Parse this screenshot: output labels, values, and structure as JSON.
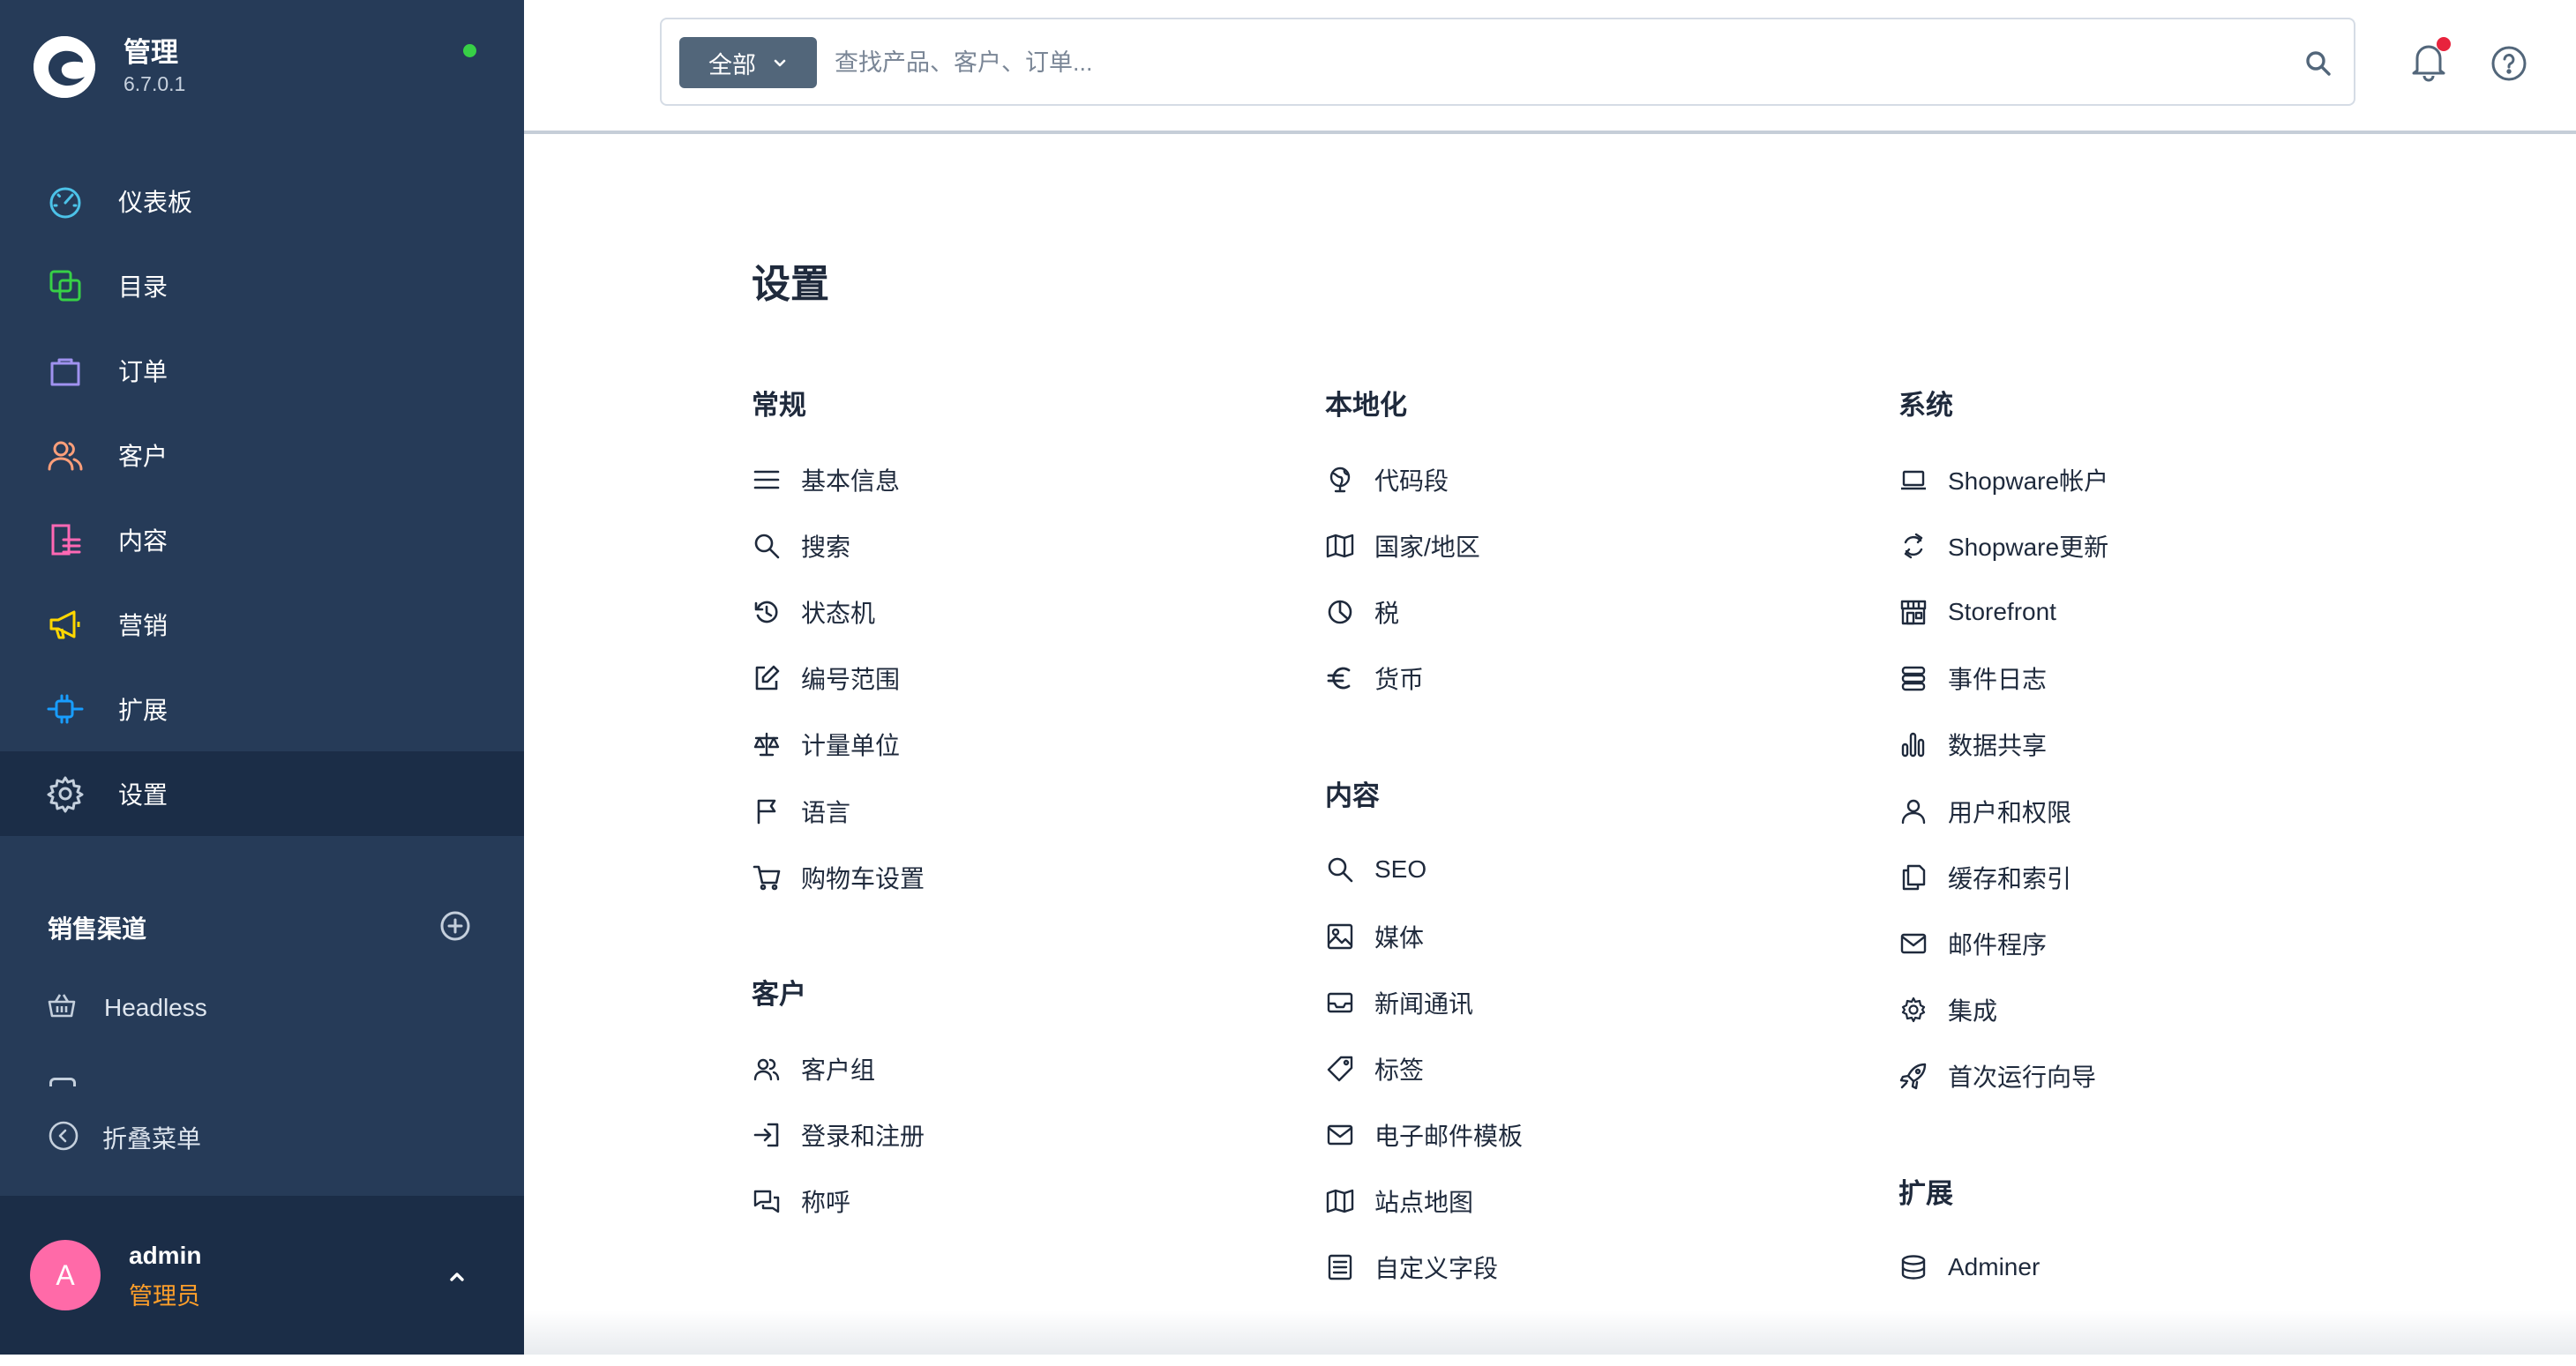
{
  "app": {
    "title": "管理",
    "version": "6.7.0.1",
    "status_color": "#37d046",
    "logo_icon": "shopware-logo-icon"
  },
  "sidebar": {
    "items": [
      {
        "label": "仪表板",
        "icon": "dashboard-gauge-icon",
        "color": "#4cc2e8"
      },
      {
        "label": "目录",
        "icon": "catalog-copy-icon",
        "color": "#37d046"
      },
      {
        "label": "订单",
        "icon": "shopping-bag-icon",
        "color": "#a092f0"
      },
      {
        "label": "客户",
        "icon": "users-icon",
        "color": "#ff9f7a"
      },
      {
        "label": "内容",
        "icon": "content-list-icon",
        "color": "#ff68b4"
      },
      {
        "label": "营销",
        "icon": "megaphone-icon",
        "color": "#ffd700"
      },
      {
        "label": "扩展",
        "icon": "plug-icon",
        "color": "#189eff"
      },
      {
        "label": "设置",
        "icon": "gear-icon",
        "color": "#c4cfdc",
        "active": true
      }
    ],
    "sales_channels": {
      "title": "销售渠道",
      "add_icon": "plus-circle-icon",
      "items": [
        {
          "label": "Headless",
          "icon": "basket-icon"
        }
      ]
    },
    "collapse_label": "折叠菜单",
    "user": {
      "initial": "A",
      "name": "admin",
      "role": "管理员",
      "avatar_color": "#ff6aa8",
      "role_color": "#ff9f2a"
    }
  },
  "topbar": {
    "scope_label": "全部",
    "search_placeholder": "查找产品、客户、订单...",
    "search_value": "",
    "notification_dot_color": "#e8233d"
  },
  "main": {
    "title": "设置",
    "columns": [
      [
        {
          "title": "常规",
          "items": [
            {
              "label": "基本信息",
              "icon": "lines-icon"
            },
            {
              "label": "搜索",
              "icon": "search-icon"
            },
            {
              "label": "状态机",
              "icon": "history-icon"
            },
            {
              "label": "编号范围",
              "icon": "edit-icon"
            },
            {
              "label": "计量单位",
              "icon": "scale-icon"
            },
            {
              "label": "语言",
              "icon": "flag-icon"
            },
            {
              "label": "购物车设置",
              "icon": "cart-icon"
            }
          ]
        },
        {
          "title": "客户",
          "items": [
            {
              "label": "客户组",
              "icon": "users-icon"
            },
            {
              "label": "登录和注册",
              "icon": "sign-in-icon"
            },
            {
              "label": "称呼",
              "icon": "chat-icon"
            }
          ]
        }
      ],
      [
        {
          "title": "本地化",
          "items": [
            {
              "label": "代码段",
              "icon": "globe-icon"
            },
            {
              "label": "国家/地区",
              "icon": "map-icon"
            },
            {
              "label": "税",
              "icon": "pie-chart-icon"
            },
            {
              "label": "货币",
              "icon": "euro-icon"
            }
          ]
        },
        {
          "title": "内容",
          "items": [
            {
              "label": "SEO",
              "icon": "search-icon"
            },
            {
              "label": "媒体",
              "icon": "image-icon"
            },
            {
              "label": "新闻通讯",
              "icon": "inbox-icon"
            },
            {
              "label": "标签",
              "icon": "tag-icon"
            },
            {
              "label": "电子邮件模板",
              "icon": "envelope-icon"
            },
            {
              "label": "站点地图",
              "icon": "map-icon"
            },
            {
              "label": "自定义字段",
              "icon": "document-list-icon"
            }
          ]
        }
      ],
      [
        {
          "title": "系统",
          "items": [
            {
              "label": "Shopware帐户",
              "icon": "laptop-icon"
            },
            {
              "label": "Shopware更新",
              "icon": "sync-icon"
            },
            {
              "label": "Storefront",
              "icon": "storefront-icon"
            },
            {
              "label": "事件日志",
              "icon": "server-icon"
            },
            {
              "label": "数据共享",
              "icon": "bar-chart-icon"
            },
            {
              "label": "用户和权限",
              "icon": "user-icon"
            },
            {
              "label": "缓存和索引",
              "icon": "files-icon"
            },
            {
              "label": "邮件程序",
              "icon": "envelope-icon"
            },
            {
              "label": "集成",
              "icon": "gear-icon"
            },
            {
              "label": "首次运行向导",
              "icon": "rocket-icon"
            }
          ]
        },
        {
          "title": "扩展",
          "items": [
            {
              "label": "Adminer",
              "icon": "database-icon"
            }
          ]
        }
      ]
    ]
  }
}
